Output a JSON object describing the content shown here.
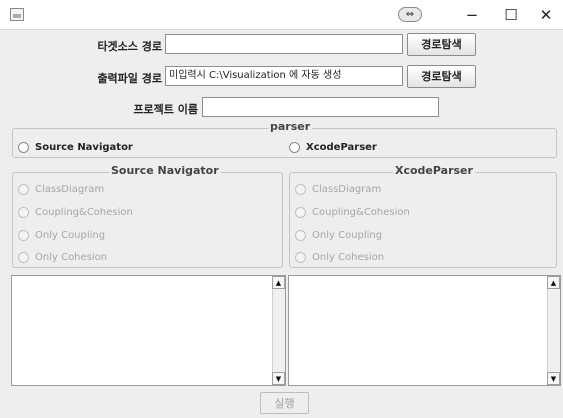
{
  "window": {
    "minimize_glyph": "−",
    "maximize_glyph": "☐",
    "close_glyph": "✕",
    "pin_glyph": "⇔"
  },
  "form": {
    "target_label": "타겟소스 경로",
    "target_value": "",
    "browse_label": "경로탐색",
    "output_label": "출력파일 경로",
    "output_value": "미입력시 C:\\Visualization 에 자동 생성",
    "project_label": "프로젝트 이름",
    "project_value": ""
  },
  "parser": {
    "title": "parser",
    "options": [
      "Source Navigator",
      "XcodeParser"
    ]
  },
  "source_navigator": {
    "title": "Source Navigator",
    "options": [
      "ClassDiagram",
      "Coupling&Cohesion",
      "Only Coupling",
      "Only Cohesion"
    ]
  },
  "xcode_parser": {
    "title": "XcodeParser",
    "options": [
      "ClassDiagram",
      "Coupling&Cohesion",
      "Only Coupling",
      "Only Cohesion"
    ]
  },
  "scroll": {
    "up_glyph": "▲",
    "down_glyph": "▼"
  },
  "run_button": "실행"
}
